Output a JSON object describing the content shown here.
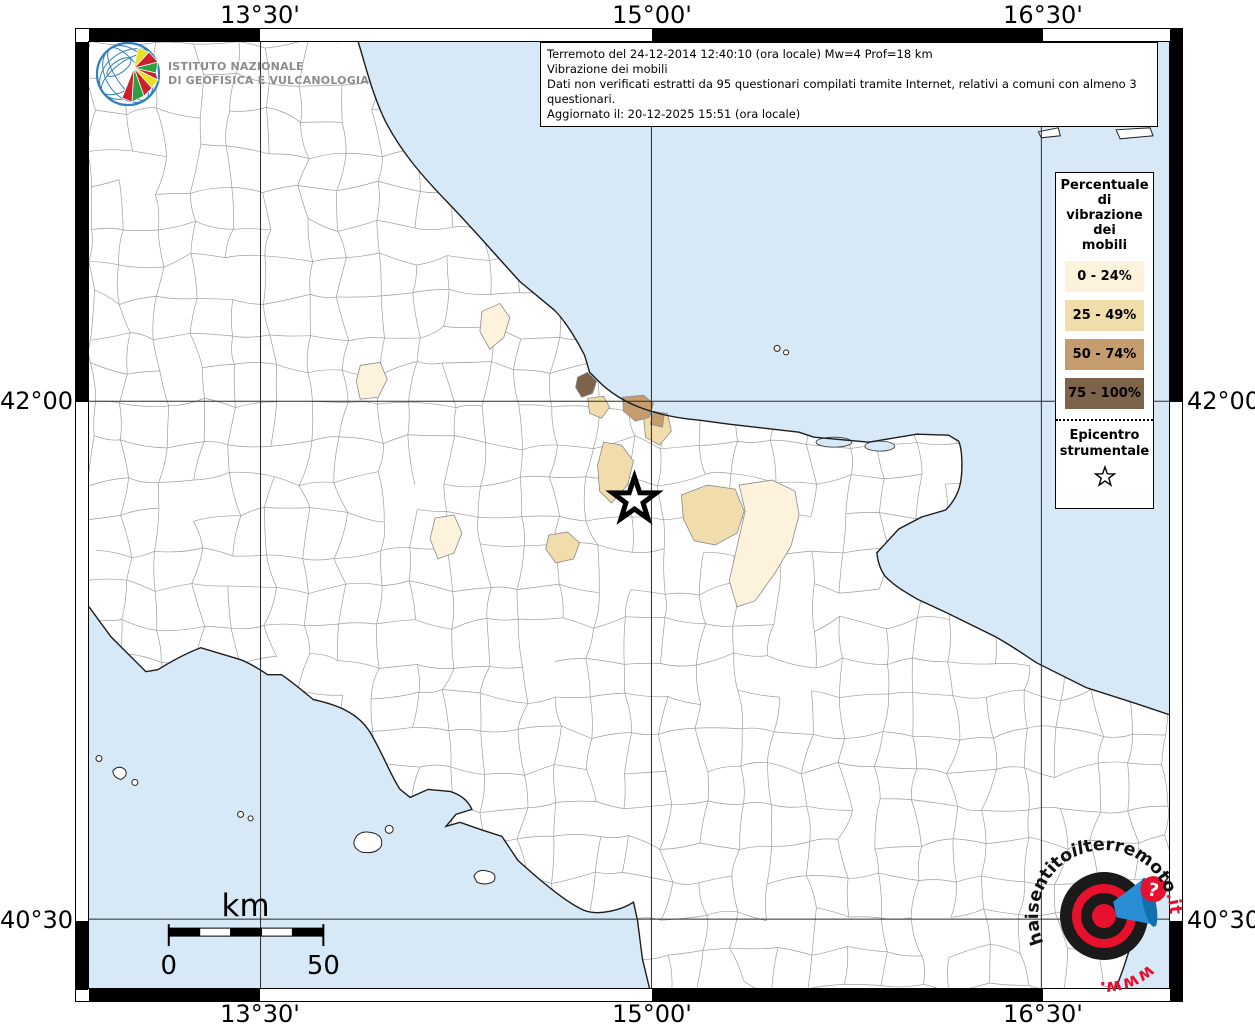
{
  "info_box": {
    "line1": "Terremoto del 24-12-2014 12:40:10 (ora locale) Mw=4 Prof=18 km",
    "line2": "Vibrazione dei mobili",
    "line3": "Dati non verificati estratti da 95 questionari compilati tramite Internet, relativi a comuni con almeno 3 questionari.",
    "line4": "Aggiornato il: 20-12-2025 15:51 (ora locale)"
  },
  "branding": {
    "line1": "ISTITUTO NAZIONALE",
    "line2": "DI GEOFISICA E VULCANOLOGIA"
  },
  "legend": {
    "title_lines": [
      "Percentuale",
      "di",
      "vibrazione",
      "dei",
      "mobili"
    ],
    "classes": [
      {
        "label": "0 - 24%",
        "color": "#fdf2dc"
      },
      {
        "label": "25 - 49%",
        "color": "#f1dcab"
      },
      {
        "label": "50 - 74%",
        "color": "#c59c6d"
      },
      {
        "label": "75 - 100%",
        "color": "#7d6349"
      }
    ],
    "epicenter_lines": [
      "Epicentro",
      "strumentale"
    ]
  },
  "map": {
    "lon_labels": [
      "13°30'",
      "15°00'",
      "16°30'"
    ],
    "lat_labels": [
      "42°00'",
      "40°30'"
    ],
    "scale_unit": "km",
    "scale_start": "0",
    "scale_end": "50",
    "sea_color": "#d7e9f7",
    "land_color": "#ffffff",
    "grid_color": "#2a2a2a"
  },
  "site_logo": {
    "prefix": "haisentito",
    "middle": "il",
    "name": "terremoto",
    "tld": ".it",
    "www": "www.",
    "question": "?",
    "accent_color": "#e8112d"
  }
}
